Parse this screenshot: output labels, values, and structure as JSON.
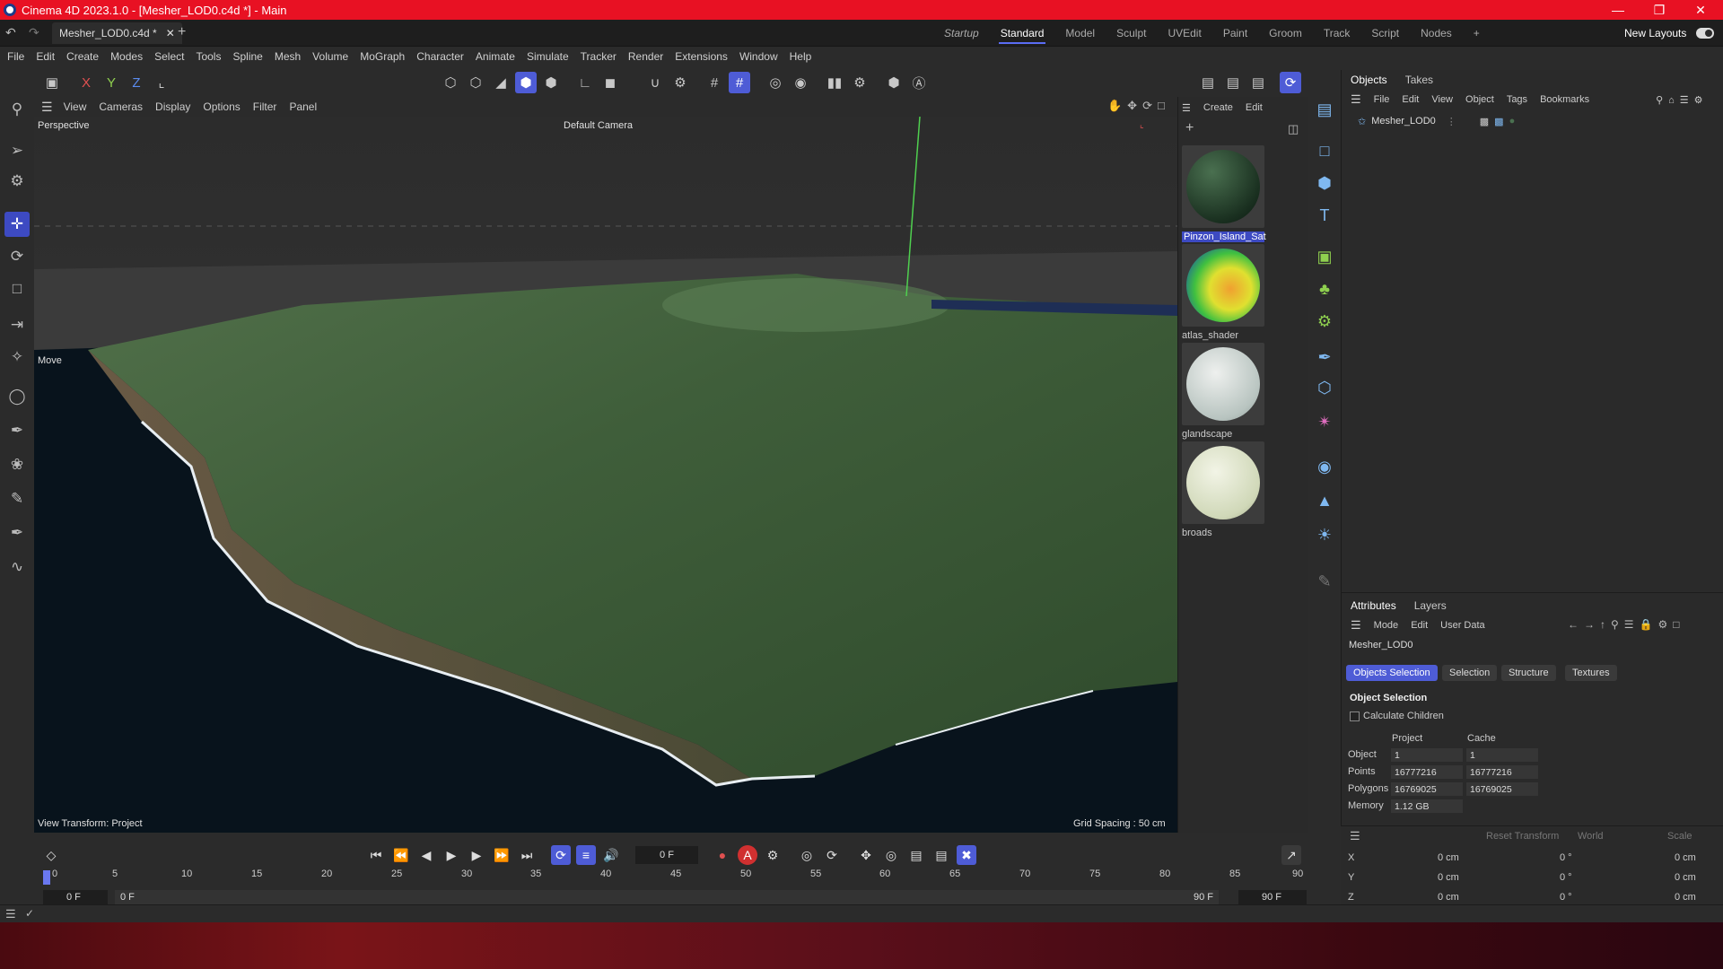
{
  "window": {
    "title": "Cinema 4D 2023.1.0 - [Mesher_LOD0.c4d *] - Main"
  },
  "document_tab": {
    "label": "Mesher_LOD0.c4d *"
  },
  "layouts": [
    "Startup",
    "Standard",
    "Model",
    "Sculpt",
    "UVEdit",
    "Paint",
    "Groom",
    "Track",
    "Script",
    "Nodes"
  ],
  "new_layouts": "New Layouts",
  "menu": [
    "File",
    "Edit",
    "Create",
    "Modes",
    "Select",
    "Tools",
    "Spline",
    "Mesh",
    "Volume",
    "MoGraph",
    "Character",
    "Animate",
    "Simulate",
    "Tracker",
    "Render",
    "Extensions",
    "Window",
    "Help"
  ],
  "axes": {
    "x": "X",
    "y": "Y",
    "z": "Z"
  },
  "viewport_menu": [
    "View",
    "Cameras",
    "Display",
    "Options",
    "Filter",
    "Panel"
  ],
  "viewport": {
    "name": "Perspective",
    "camera": "Default Camera",
    "tool": "Move",
    "view_transform": "View Transform: Project",
    "grid_spacing": "Grid Spacing : 50 cm"
  },
  "material_menu": [
    "Create",
    "Edit"
  ],
  "materials": [
    "Pinzon_Island_Sat",
    "atlas_shader",
    "glandscape",
    "broads"
  ],
  "objects_panel": {
    "tabs": [
      "Objects",
      "Takes"
    ],
    "menu": [
      "File",
      "Edit",
      "View",
      "Object",
      "Tags",
      "Bookmarks"
    ],
    "items": [
      {
        "name": "Mesher_LOD0"
      }
    ]
  },
  "attributes_panel": {
    "tabs": [
      "Attributes",
      "Layers"
    ],
    "menu": [
      "Mode",
      "Edit",
      "User Data"
    ],
    "object_name": "Mesher_LOD0",
    "subtabs": [
      "Objects Selection",
      "Selection",
      "Structure",
      "Textures"
    ],
    "section_title": "Object Selection",
    "calculate_children": "Calculate Children",
    "columns": [
      "Project",
      "Cache"
    ],
    "rows": [
      {
        "label": "Object",
        "project": "1",
        "cache": "1"
      },
      {
        "label": "Points",
        "project": "16777216",
        "cache": "16777216"
      },
      {
        "label": "Polygons",
        "project": "16769025",
        "cache": "16769025"
      },
      {
        "label": "Memory",
        "project": "1.12 GB",
        "cache": ""
      }
    ]
  },
  "coordinates": {
    "reset_transform": "Reset Transform",
    "space": "World",
    "mode": "Scale",
    "rows": [
      {
        "axis": "X",
        "pos": "0 cm",
        "rot": "0 °",
        "scale": "0 cm"
      },
      {
        "axis": "Y",
        "pos": "0 cm",
        "rot": "0 °",
        "scale": "0 cm"
      },
      {
        "axis": "Z",
        "pos": "0 cm",
        "rot": "0 °",
        "scale": "0 cm"
      }
    ]
  },
  "timeline": {
    "current_frame": "0 F",
    "ticks": [
      "0",
      "5",
      "10",
      "15",
      "20",
      "25",
      "30",
      "35",
      "40",
      "45",
      "50",
      "55",
      "60",
      "65",
      "70",
      "75",
      "80",
      "85",
      "90"
    ],
    "start": "0 F",
    "range_start": "0 F",
    "range_end": "90 F",
    "end": "90 F"
  },
  "colors": {
    "accent": "#4e5cd6",
    "title_bar": "#e81123"
  }
}
